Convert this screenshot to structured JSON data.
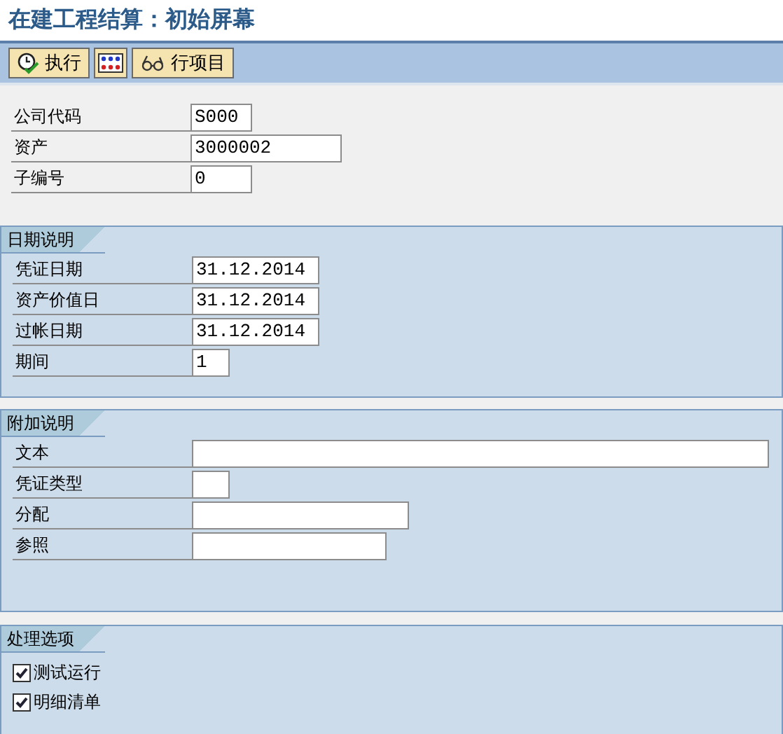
{
  "title": "在建工程结算：初始屏幕",
  "toolbar": [
    {
      "kind": "execute",
      "label": "执行"
    },
    {
      "kind": "layout"
    },
    {
      "kind": "line-items",
      "label": "行项目"
    }
  ],
  "header_fields": [
    {
      "label": "公司代码",
      "value": "S000"
    },
    {
      "label": "资产",
      "value": "3000002"
    },
    {
      "label": "子编号",
      "value": "0"
    }
  ],
  "groups": [
    {
      "kind": "fields",
      "title": "日期说明",
      "fields": [
        {
          "label": "凭证日期",
          "value": "31.12.2014"
        },
        {
          "label": "资产价值日",
          "value": "31.12.2014"
        },
        {
          "label": "过帐日期",
          "value": "31.12.2014"
        },
        {
          "label": "期间",
          "value": "1"
        }
      ]
    },
    {
      "kind": "fields",
      "title": "附加说明",
      "fields": [
        {
          "label": "文本"
        },
        {
          "label": "凭证类型"
        },
        {
          "label": "分配"
        },
        {
          "label": "参照"
        }
      ]
    },
    {
      "kind": "checks",
      "title": "处理选项",
      "options": [
        {
          "label": "测试运行",
          "checked": true
        },
        {
          "label": "明细清单",
          "checked": true
        }
      ]
    }
  ]
}
